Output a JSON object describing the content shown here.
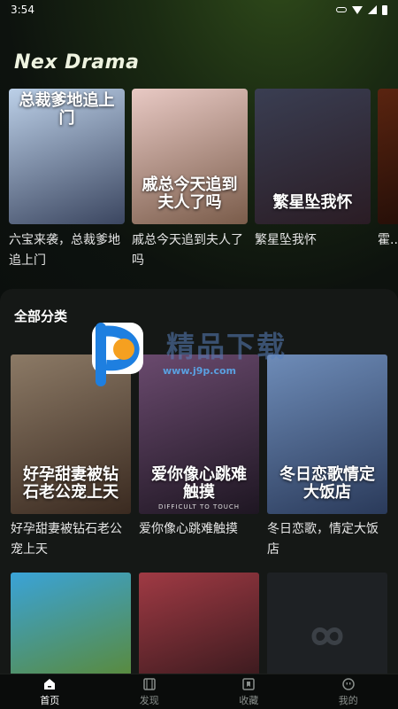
{
  "status_bar": {
    "time": "3:54"
  },
  "app": {
    "brand": "Nex Drama"
  },
  "featured": [
    {
      "title": "六宝来袭，总裁爹地追上门",
      "poster_text": "总裁爹地追上门",
      "colors": [
        "#bcd0e8",
        "#3b4660"
      ]
    },
    {
      "title": "戚总今天追到夫人了吗",
      "poster_text": "戚总今天追到夫人了吗",
      "colors": [
        "#e8c9c4",
        "#7a5c4a"
      ]
    },
    {
      "title": "繁星坠我怀",
      "poster_text": "繁星坠我怀",
      "colors": [
        "#3a3e52",
        "#2a1c24"
      ]
    },
    {
      "title": "霍...又...",
      "poster_text": "",
      "colors": [
        "#5a2410",
        "#1a0a06"
      ]
    }
  ],
  "section": {
    "title": "全部分类",
    "items": [
      {
        "title": "好孕甜妻被钻石老公宠上天",
        "poster_text": "好孕甜妻被钻石老公宠上天",
        "colors": [
          "#8c7a66",
          "#3a2a20"
        ]
      },
      {
        "title": "爱你像心跳难触摸",
        "poster_text": "爱你像心跳难触摸",
        "subtitle": "DIFFICULT TO TOUCH",
        "colors": [
          "#6a4a6e",
          "#1e1622"
        ]
      },
      {
        "title": "冬日恋歌，情定大饭店",
        "poster_text": "冬日恋歌情定大饭店",
        "colors": [
          "#6e8cb8",
          "#2a3a5a"
        ]
      },
      {
        "title": "",
        "poster_text": "",
        "colors": [
          "#3aa3d8",
          "#5a8a3a"
        ]
      },
      {
        "title": "",
        "poster_text": "",
        "colors": [
          "#a03a44",
          "#3a1a1e"
        ]
      },
      {
        "title": "",
        "poster_text": "",
        "colors": [
          "#1e2124",
          "#1e2124"
        ],
        "placeholder": true
      }
    ]
  },
  "watermark": {
    "text": "精品下载",
    "url": "www.j9p.com"
  },
  "tabs": [
    {
      "label": "首页",
      "icon": "home-icon",
      "active": true
    },
    {
      "label": "发现",
      "icon": "film-icon",
      "active": false
    },
    {
      "label": "收藏",
      "icon": "bookmark-icon",
      "active": false
    },
    {
      "label": "我的",
      "icon": "profile-icon",
      "active": false
    }
  ]
}
